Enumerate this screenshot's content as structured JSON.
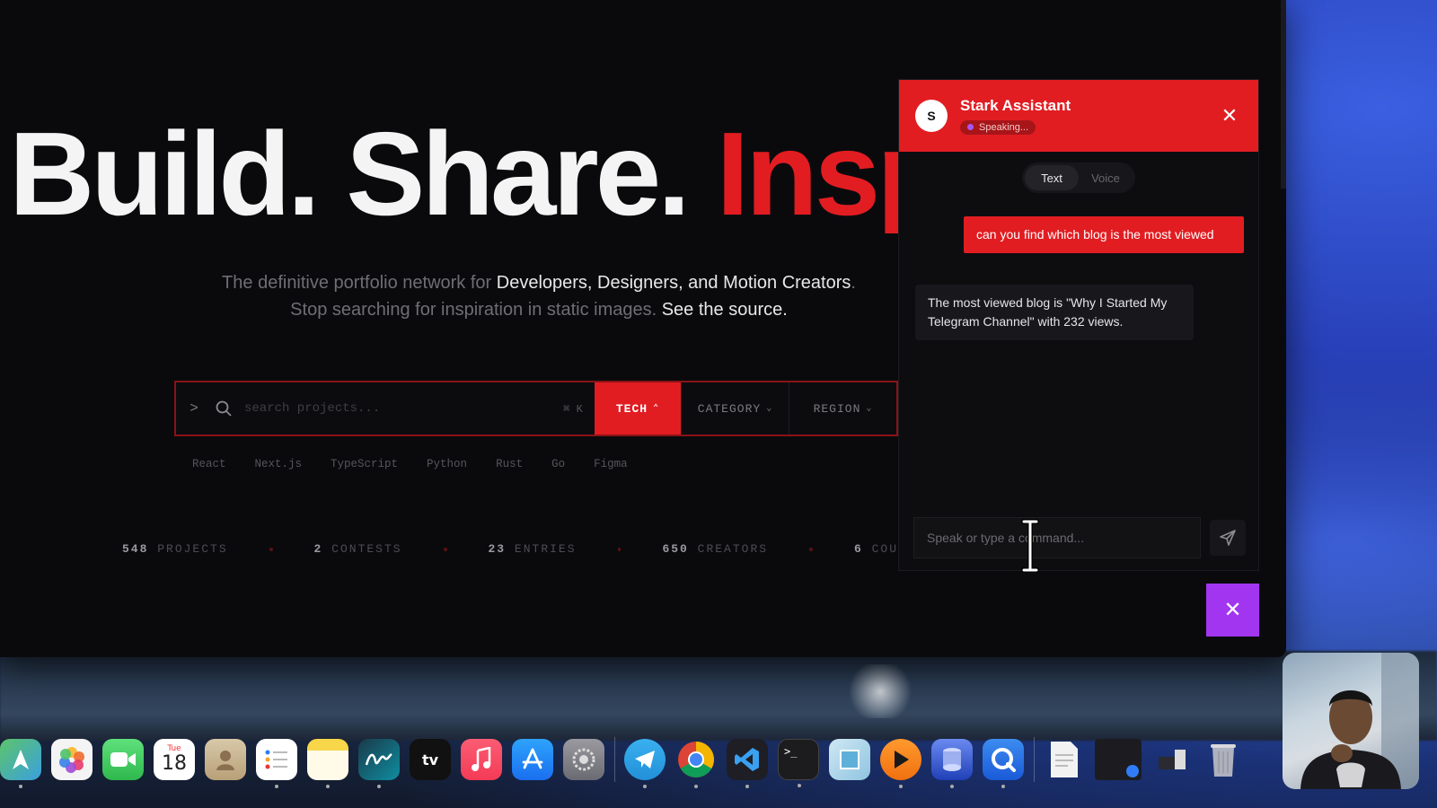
{
  "hero": {
    "title_part1": "Build. Share. ",
    "title_accent": "Insp",
    "subtitle_line1_pre": "The definitive portfolio network for ",
    "subtitle_line1_hl": "Developers, Designers, and Motion Creators",
    "subtitle_line1_post": ".",
    "subtitle_line2_pre": "Stop searching for inspiration in static images. ",
    "subtitle_line2_hl": "See the source."
  },
  "search": {
    "prompt": ">",
    "placeholder": "search projects...",
    "shortcut": "⌘ K",
    "tech_label": "TECH",
    "category_label": "CATEGORY",
    "region_label": "REGION"
  },
  "tech_chips": [
    "React",
    "Next.js",
    "TypeScript",
    "Python",
    "Rust",
    "Go",
    "Figma"
  ],
  "stats": [
    {
      "value": "548",
      "label": "PROJECTS"
    },
    {
      "value": "2",
      "label": "CONTESTS"
    },
    {
      "value": "23",
      "label": "ENTRIES"
    },
    {
      "value": "650",
      "label": "CREATORS"
    },
    {
      "value": "6",
      "label": "COU"
    }
  ],
  "assistant": {
    "avatar_letter": "S",
    "name": "Stark Assistant",
    "status": "Speaking...",
    "close_symbol": "✕",
    "modes": {
      "text": "Text",
      "voice": "Voice"
    },
    "user_message": "can you find which blog is the most viewed",
    "bot_message": "The most viewed blog is \"Why I Started My Telegram Channel\" with 232 views.",
    "input_placeholder": "Speak or type a command..."
  },
  "fab": {
    "close_symbol": "✕"
  },
  "colors": {
    "accent": "#e11d22",
    "fab": "#a235f0",
    "background": "#0a0a0d"
  },
  "dock": {
    "calendar_month": "Tue",
    "calendar_day": "18",
    "tv_label": "tv",
    "apps": [
      "maps-icon",
      "photos-icon",
      "facetime-icon",
      "calendar-icon",
      "contacts-icon",
      "reminders-icon",
      "notes-icon",
      "freeform-icon",
      "apple-tv-icon",
      "music-icon",
      "app-store-icon",
      "system-settings-icon",
      "telegram-icon",
      "chrome-icon",
      "vscode-icon",
      "terminal-icon",
      "preview-icon",
      "infuse-icon",
      "db-browser-icon",
      "quicktime-icon",
      "document-icon",
      "screenshot-window-icon",
      "downloads-icon",
      "trash-icon"
    ]
  }
}
